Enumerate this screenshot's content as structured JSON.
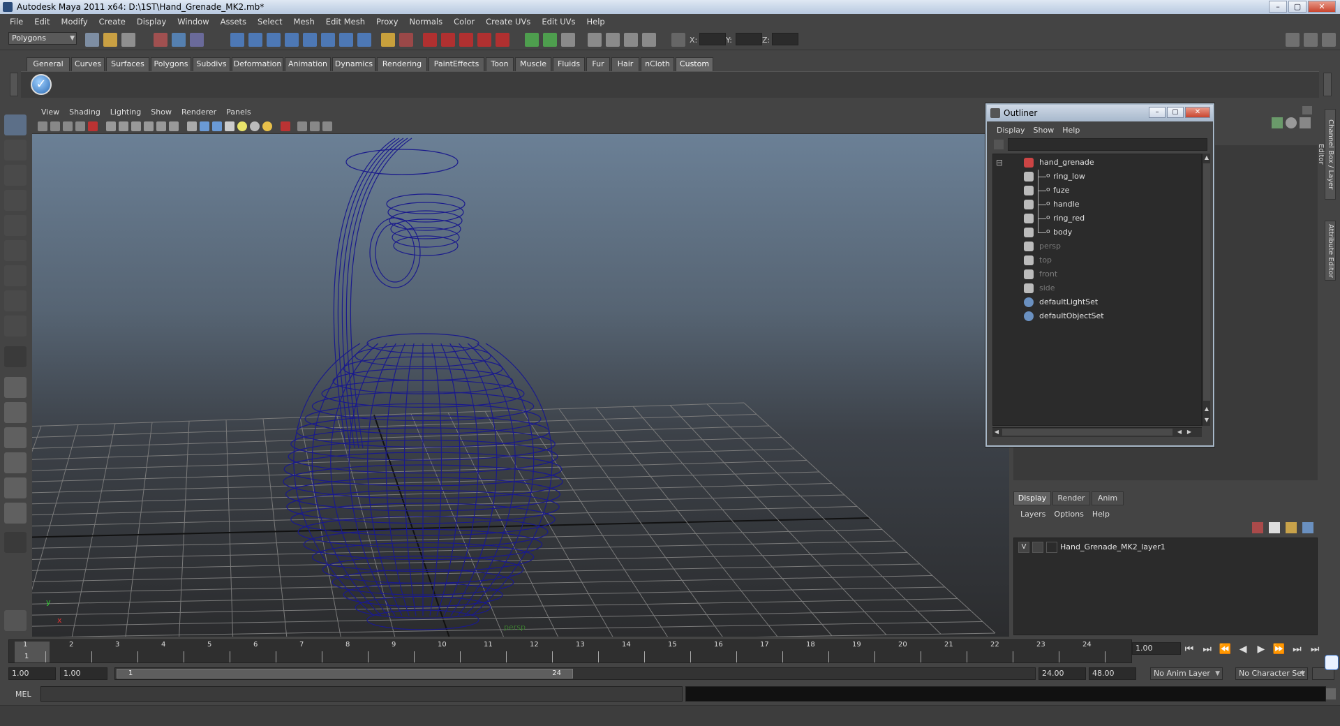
{
  "window": {
    "title": "Autodesk Maya 2011 x64: D:\\1ST\\Hand_Grenade_MK2.mb*",
    "controls": [
      "–",
      "▢",
      "✕"
    ]
  },
  "menubar": [
    "File",
    "Edit",
    "Modify",
    "Create",
    "Display",
    "Window",
    "Assets",
    "Select",
    "Mesh",
    "Edit Mesh",
    "Proxy",
    "Normals",
    "Color",
    "Create UVs",
    "Edit UVs",
    "Help"
  ],
  "statusline": {
    "mode": "Polygons",
    "coord_labels": [
      "X:",
      "Y:",
      "Z:"
    ]
  },
  "shelf": {
    "tabs": [
      "General",
      "Curves",
      "Surfaces",
      "Polygons",
      "Subdivs",
      "Deformation",
      "Animation",
      "Dynamics",
      "Rendering",
      "PaintEffects",
      "Toon",
      "Muscle",
      "Fluids",
      "Fur",
      "Hair",
      "nCloth",
      "Custom"
    ],
    "active_tab": "Custom",
    "check_glyph": "✓"
  },
  "viewport": {
    "menu": [
      "View",
      "Shading",
      "Lighting",
      "Show",
      "Renderer",
      "Panels"
    ],
    "camera_label": "persp",
    "axis_x": "x",
    "axis_y": "y",
    "wire_color": "#1a1a8c"
  },
  "outliner": {
    "title": "Outliner",
    "menu": [
      "Display",
      "Show",
      "Help"
    ],
    "items": [
      {
        "name": "hand_grenade",
        "level": 0,
        "dim": false,
        "expander": "⊟"
      },
      {
        "name": "ring_low",
        "level": 1,
        "dim": false
      },
      {
        "name": "fuze",
        "level": 1,
        "dim": false
      },
      {
        "name": "handle",
        "level": 1,
        "dim": false
      },
      {
        "name": "ring_red",
        "level": 1,
        "dim": false
      },
      {
        "name": "body",
        "level": 1,
        "dim": false
      },
      {
        "name": "persp",
        "level": 0,
        "dim": true
      },
      {
        "name": "top",
        "level": 0,
        "dim": true
      },
      {
        "name": "front",
        "level": 0,
        "dim": true
      },
      {
        "name": "side",
        "level": 0,
        "dim": true
      },
      {
        "name": "defaultLightSet",
        "level": 0,
        "dim": false
      },
      {
        "name": "defaultObjectSet",
        "level": 0,
        "dim": false
      }
    ]
  },
  "side_tabs": [
    "Channel Box / Layer Editor",
    "Attribute Editor"
  ],
  "layer_editor": {
    "tabs": [
      "Display",
      "Render",
      "Anim"
    ],
    "active_tab": "Display",
    "menu": [
      "Layers",
      "Options",
      "Help"
    ],
    "layer": {
      "visible": "V",
      "name": "Hand_Grenade_MK2_layer1"
    }
  },
  "timeline": {
    "frames": [
      "1",
      "2",
      "3",
      "4",
      "5",
      "6",
      "7",
      "8",
      "9",
      "10",
      "11",
      "12",
      "13",
      "14",
      "15",
      "16",
      "17",
      "18",
      "19",
      "20",
      "21",
      "22",
      "23",
      "24"
    ],
    "current_frame_marker": "1",
    "current_frame_field": "1.00",
    "playback": [
      "⏮",
      "⏭",
      "⏪",
      "◀",
      "▶",
      "⏩",
      "⏭",
      "⏭"
    ]
  },
  "range": {
    "start_field": "1.00",
    "start_inner": "1.00",
    "range_start": "1",
    "range_end": "24",
    "end_field": "24.00",
    "end_outer": "48.00",
    "anim_layer": "No Anim Layer",
    "character_set": "No Character Set"
  },
  "commandline": {
    "label": "MEL"
  }
}
